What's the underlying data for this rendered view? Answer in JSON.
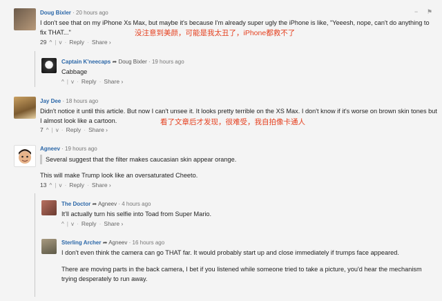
{
  "comments": [
    {
      "author": "Doug Bixler",
      "time": "20 hours ago",
      "text": "I don't see that on my iPhone Xs Max, but maybe it's because I'm already super ugly the iPhone is like, \"Yeeesh, nope, can't do anything to fix THAT...\"",
      "annotation": "没注意到美颜，可能是我太丑了，iPhone都救不了",
      "votes": "29",
      "reply": "Reply",
      "share": "Share ›"
    },
    {
      "author": "Captain K'neecaps",
      "reply_to": "Doug Bixler",
      "time": "19 hours ago",
      "text": "Cabbage",
      "reply": "Reply",
      "share": "Share ›"
    },
    {
      "author": "Jay Dee",
      "time": "18 hours ago",
      "text": "Didn't notice it until this article. But now I can't unsee it. It looks pretty terrible on the XS Max. I don't know if it's worse on brown skin tones but I almost look like a cartoon.",
      "annotation": "看了文章后才发现，很难受，我自拍像卡通人",
      "votes": "7",
      "reply": "Reply",
      "share": "Share ›"
    },
    {
      "author": "Agneev",
      "time": "19 hours ago",
      "quote": "Several suggest that the filter makes caucasian skin appear orange.",
      "text": "This will make Trump look like an oversaturated Cheeto.",
      "votes": "13",
      "reply": "Reply",
      "share": "Share ›"
    },
    {
      "author": "The Doctor",
      "reply_to": "Agneev",
      "time": "4 hours ago",
      "text": "It'll actually turn his selfie into Toad from Super Mario.",
      "reply": "Reply",
      "share": "Share ›"
    },
    {
      "author": "Sterling Archer",
      "reply_to": "Agneev",
      "time": "16 hours ago",
      "text1": "I don't even think the camera can go THAT far. It would probably start up and close immediately if trumps face appeared.",
      "text2": "There are moving parts in the back camera, I bet if you listened while someone tried to take a picture, you'd hear the mechanism trying desperately to run away."
    }
  ],
  "ui": {
    "upvote": "^",
    "downvote": "v",
    "dot": "·",
    "reply_arrow": "➦",
    "collapse": "−",
    "flag": "⚑"
  },
  "colors": {
    "author": "#2b67a8",
    "annotation": "#e5401f",
    "background": "#f4f4f4"
  }
}
